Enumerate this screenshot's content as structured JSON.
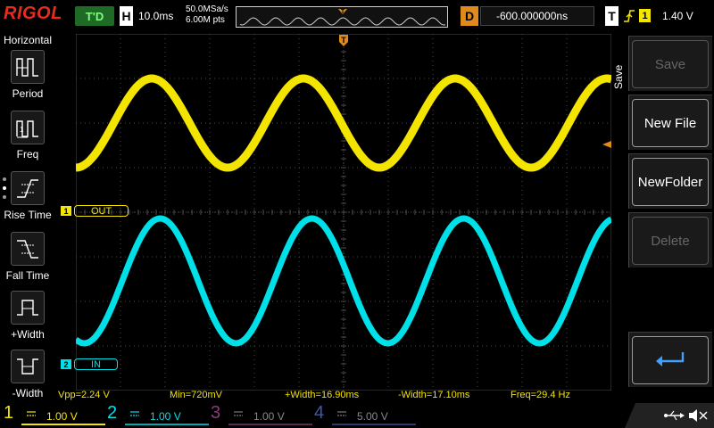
{
  "topbar": {
    "logo": "RIGOL",
    "run_status": "T'D",
    "horizontal_label": "H",
    "timebase": "10.0ms",
    "sample_rate": "50.0MSa/s",
    "memory_depth": "6.00M pts",
    "trigger_pos_marker": "T",
    "delay_label": "D",
    "delay_value": "-600.000000ns",
    "trigger_label": "T",
    "trigger_source": "1",
    "trigger_level": "1.40 V"
  },
  "left_menu": {
    "title": "Horizontal",
    "items": [
      {
        "label": "Period",
        "icon": "period-icon"
      },
      {
        "label": "Freq",
        "icon": "frequency-icon"
      },
      {
        "label": "Rise Time",
        "icon": "rise-time-icon"
      },
      {
        "label": "Fall Time",
        "icon": "fall-time-icon"
      },
      {
        "label": "+Width",
        "icon": "positive-width-icon"
      },
      {
        "label": "-Width",
        "icon": "negative-width-icon"
      }
    ]
  },
  "plot": {
    "ch1_num": "1",
    "ch1_label": "OUT",
    "ch2_num": "2",
    "ch2_label": "IN",
    "trigger_marker": "T",
    "colors": {
      "ch1": "#f4e500",
      "ch2": "#00e0e8",
      "grid": "#4a4a4a",
      "trigger": "#e08a1e"
    }
  },
  "measurements": {
    "vpp": "Vpp=2.24 V",
    "min": "Min=720mV",
    "pos_width": "+Width=16.90ms",
    "neg_width": "-Width=17.10ms",
    "freq": "Freq=29.4 Hz"
  },
  "right_menu": {
    "title": "Save",
    "keys": [
      {
        "label": "Save",
        "enabled": false
      },
      {
        "label": "New File",
        "enabled": true
      },
      {
        "label": "NewFolder",
        "enabled": true
      },
      {
        "label": "Delete",
        "enabled": false
      },
      {
        "label": "",
        "enabled": true,
        "icon": "return-arrow-icon"
      }
    ]
  },
  "channels": [
    {
      "num": "1",
      "scale": "1.00 V",
      "color": "#f4e500",
      "active": true
    },
    {
      "num": "2",
      "scale": "1.00 V",
      "color": "#00e0e8",
      "active": true
    },
    {
      "num": "3",
      "scale": "1.00 V",
      "color": "#d03fb0",
      "active": false
    },
    {
      "num": "4",
      "scale": "5.00 V",
      "color": "#3a6bd8",
      "active": false
    }
  ]
}
